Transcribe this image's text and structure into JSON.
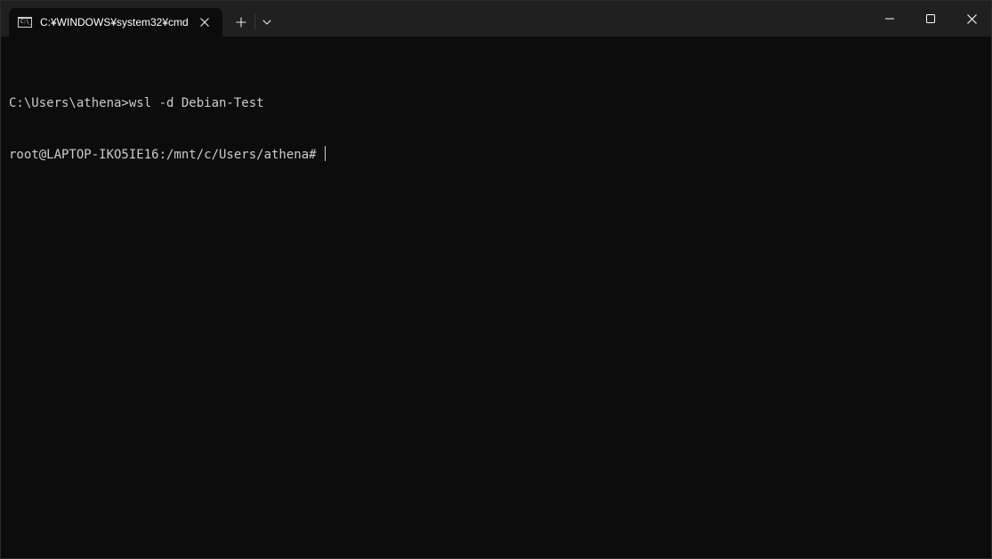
{
  "window": {
    "tab_title": "C:¥WINDOWS¥system32¥cmd",
    "tab_icon_text": "C:\\_"
  },
  "icons": {
    "tab": "cmd-icon",
    "close_tab": "close-icon",
    "new_tab": "plus-icon",
    "dropdown": "chevron-down-icon",
    "minimize": "minimize-icon",
    "maximize": "maximize-icon",
    "close_window": "close-icon"
  },
  "colors": {
    "background": "#0c0c0c",
    "titlebar": "#202020",
    "text": "#cccccc"
  },
  "console": {
    "lines": [
      "C:\\Users\\athena>wsl -d Debian-Test",
      "root@LAPTOP-IKO5IE16:/mnt/c/Users/athena# "
    ]
  }
}
